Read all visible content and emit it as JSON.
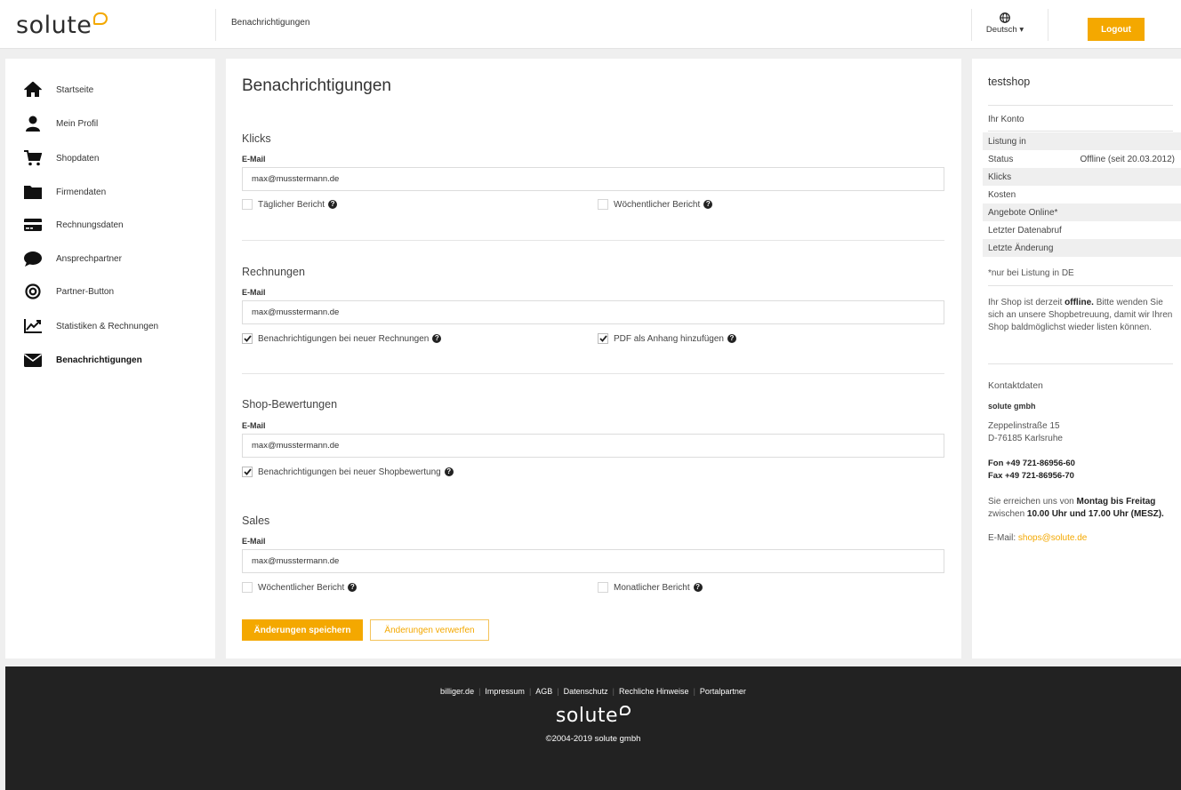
{
  "header": {
    "logo_text": "solute",
    "breadcrumb": "Benachrichtigungen",
    "language": "Deutsch ▾",
    "logout_label": "Logout"
  },
  "sidebar": {
    "items": [
      {
        "label": "Startseite",
        "icon": "home-icon"
      },
      {
        "label": "Mein Profil",
        "icon": "user-icon"
      },
      {
        "label": "Shopdaten",
        "icon": "cart-icon"
      },
      {
        "label": "Firmendaten",
        "icon": "folder-icon"
      },
      {
        "label": "Rechnungsdaten",
        "icon": "credit-card-icon"
      },
      {
        "label": "Ansprechpartner",
        "icon": "chat-bubble-icon"
      },
      {
        "label": "Partner-Button",
        "icon": "target-icon"
      },
      {
        "label": "Statistiken & Rechnungen",
        "icon": "chart-icon"
      },
      {
        "label": "Benachrichtigungen",
        "icon": "envelope-icon"
      }
    ]
  },
  "main": {
    "title": "Benachrichtigungen",
    "email_label": "E-Mail",
    "sections": {
      "klicks": {
        "title": "Klicks",
        "email": "max@musstermann.de",
        "check1": "Täglicher Bericht",
        "check2": "Wöchentlicher Bericht"
      },
      "rechnungen": {
        "title": "Rechnungen",
        "email": "max@musstermann.de",
        "check1": "Benachrichtigungen bei neuer Rechnungen",
        "check2": "PDF als Anhang hinzufügen"
      },
      "bewertungen": {
        "title": "Shop-Bewertungen",
        "email": "max@musstermann.de",
        "check1": "Benachrichtigungen bei neuer Shopbewertung"
      },
      "sales": {
        "title": "Sales",
        "email": "max@musstermann.de",
        "check1": "Wöchentlicher Bericht",
        "check2": "Monatlicher Bericht"
      }
    },
    "save_label": "Änderungen speichern",
    "discard_label": "Änderungen verwerfen"
  },
  "right": {
    "shop_name": "testshop",
    "account_heading": "Ihr Konto",
    "rows": [
      {
        "label": "Listung in",
        "value": ""
      },
      {
        "label": "Status",
        "value": "Offline (seit 20.03.2012)"
      },
      {
        "label": "Klicks",
        "value": ""
      },
      {
        "label": "Kosten",
        "value": ""
      },
      {
        "label": "Angebote Online*",
        "value": ""
      },
      {
        "label": "Letzter Datenabruf",
        "value": ""
      },
      {
        "label": "Letzte Änderung",
        "value": ""
      }
    ],
    "note": "*nur bei Listung in DE",
    "msg_pre": "Ihr Shop ist derzeit ",
    "msg_bold": "offline.",
    "msg_post": " Bitte wenden Sie sich an unsere Shopbetreuung, damit wir Ihren Shop baldmöglichst wieder listen können.",
    "contact_title": "Kontaktdaten",
    "company": "solute gmbh",
    "street": "Zeppelinstraße 15",
    "city": "D-76185 Karlsruhe",
    "phone": "Fon +49 721-86956-60",
    "fax": "Fax +49 721-86956-70",
    "hours_pre": "Sie erreichen uns von ",
    "hours_days": "Montag bis Freitag",
    "hours_mid": " zwischen ",
    "hours_time": "10.00 Uhr und 17.00 Uhr (MESZ).",
    "email_prefix": "E-Mail: ",
    "email": "shops@solute.de"
  },
  "footer": {
    "links": [
      "billiger.de",
      "Impressum",
      "AGB",
      "Datenschutz",
      "Rechliche Hinweise",
      "Portalpartner"
    ],
    "logo_text": "solute",
    "copyright": "©2004-2019 solute gmbh"
  },
  "colors": {
    "accent": "#f4a800",
    "footer_bg": "#222222"
  }
}
